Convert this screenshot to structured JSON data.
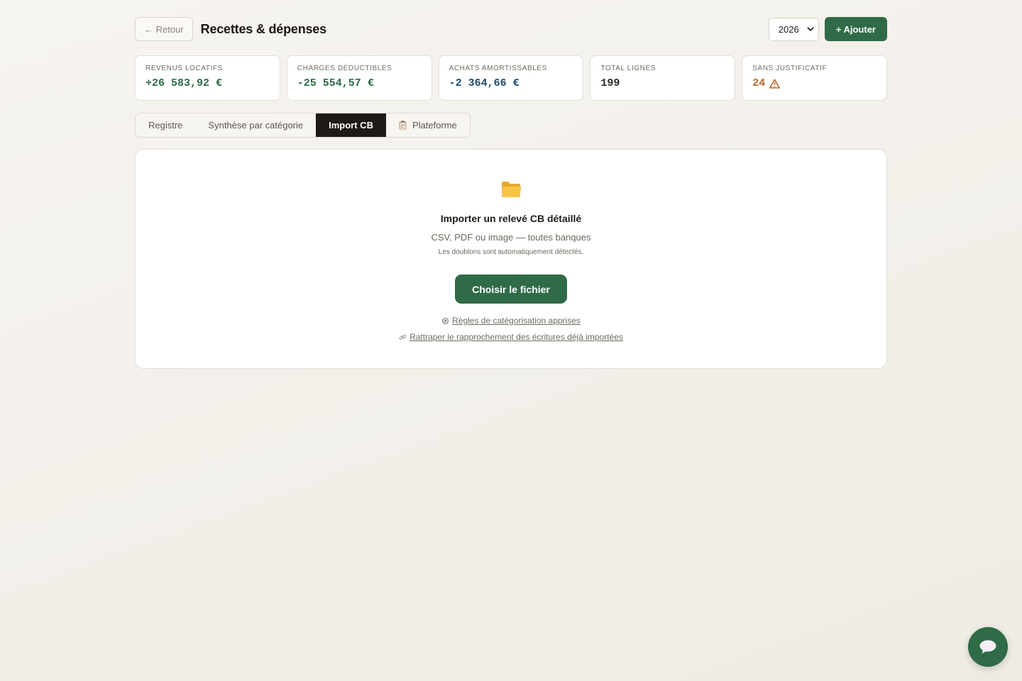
{
  "header": {
    "back_label": "← Retour",
    "title": "Recettes & dépenses",
    "year": "2026",
    "add_label": "+ Ajouter"
  },
  "stats": [
    {
      "label": "Revenus locatifs",
      "value": "+26 583,92 €",
      "color": "#2c6b45"
    },
    {
      "label": "Charges déductibles",
      "value": "-25 554,57 €",
      "color": "#2c6b45"
    },
    {
      "label": "Achats amortissables",
      "value": "-2 364,66 €",
      "color": "#1f4a6e"
    },
    {
      "label": "Total lignes",
      "value": "199",
      "color": "#2b2722"
    },
    {
      "label": "Sans justificatif",
      "value": "24",
      "color": "#b86a2e",
      "icon": "warning-icon"
    }
  ],
  "tabs": [
    {
      "label": "Registre",
      "active": false
    },
    {
      "label": "Synthèse par catégorie",
      "active": false
    },
    {
      "label": "Import CB",
      "active": true
    },
    {
      "label": "Plateforme",
      "active": false,
      "icon": "clipboard-icon"
    }
  ],
  "import": {
    "icon": "folder-icon",
    "title": "Importer un relevé CB détaillé",
    "subtitle": "CSV, PDF ou image — toutes banques",
    "note": "Les doublons sont automatiquement détectés.",
    "button_label": "Choisir le fichier",
    "link_rules": "Règles de catégorisation apprises",
    "link_reconcile": "Rattraper le rapprochement des écritures déjà importées"
  },
  "colors": {
    "accent": "#2f6b47",
    "active_tab": "#1e1a15"
  }
}
